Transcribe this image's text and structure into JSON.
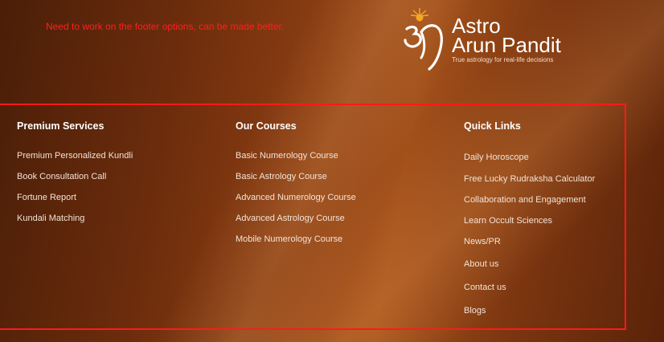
{
  "note": "Need to work on the footer options, can be made better.",
  "logo": {
    "line1": "Astro",
    "line2": "Arun Pandit",
    "tagline": "True astrology for real-life decisions",
    "icon": "om-sun-logo-icon"
  },
  "columns": [
    {
      "heading": "Premium Services",
      "items": [
        "Premium Personalized Kundli",
        "Book Consultation Call",
        "Fortune Report",
        "Kundali Matching"
      ]
    },
    {
      "heading": "Our Courses",
      "items": [
        "Basic Numerology Course",
        "Basic Astrology Course",
        "Advanced Numerology Course",
        "Advanced Astrology Course",
        "Mobile Numerology Course"
      ]
    },
    {
      "heading": "Quick Links",
      "items": [
        "Daily Horoscope",
        "Free Lucky Rudraksha Calculator",
        "Collaboration and Engagement",
        "Learn Occult Sciences",
        "News/PR",
        "About us",
        "Contact us",
        "Blogs"
      ]
    }
  ],
  "colors": {
    "note": "#ff1f1f",
    "border": "#ff1a1a",
    "text": "#ffffff"
  }
}
